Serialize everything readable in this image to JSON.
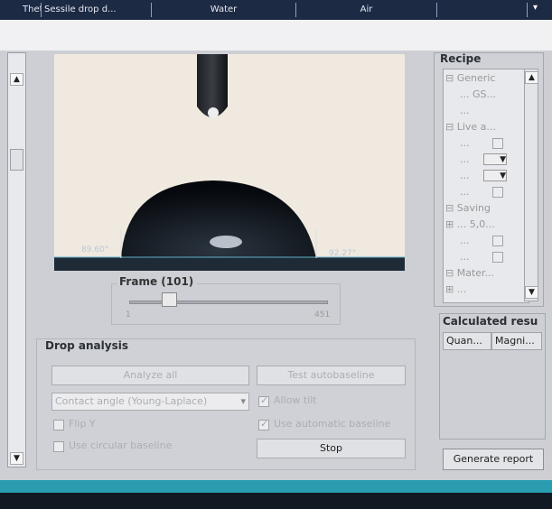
{
  "header": {
    "cells": [
      "Theta",
      "Sessile drop d...",
      "Water",
      "Air"
    ]
  },
  "image": {
    "left_angle": "89.60°",
    "right_angle": "92.27°"
  },
  "frame": {
    "title": "Frame (101)",
    "min": "1",
    "max": "451"
  },
  "drop_analysis": {
    "title": "Drop analysis",
    "analyze_all": "Analyze all",
    "test_autobaseline": "Test autobaseline",
    "method": "Contact angle (Young-Laplace)",
    "allow_tilt": "Allow tilt",
    "flip_y": "Flip Y",
    "use_automatic_baseline": "Use automatic baseline",
    "use_circular_baseline": "Use circular baseline",
    "stop": "Stop"
  },
  "recipe": {
    "title": "Recipe",
    "rows": [
      "Generic",
      "... GS...",
      "...",
      "Live a...",
      "...",
      "...",
      "...",
      "...",
      "Saving",
      "... 5,0...",
      "...",
      "...",
      "Mater...",
      "..."
    ]
  },
  "calculated": {
    "title": "Calculated resu",
    "col1": "Quan...",
    "col2": "Magni..."
  },
  "generate_report": "Generate report",
  "colors": {
    "header_bg": "#1d2a44",
    "panel_bg": "#cdcfd4",
    "accent_teal": "#2a9db0"
  }
}
